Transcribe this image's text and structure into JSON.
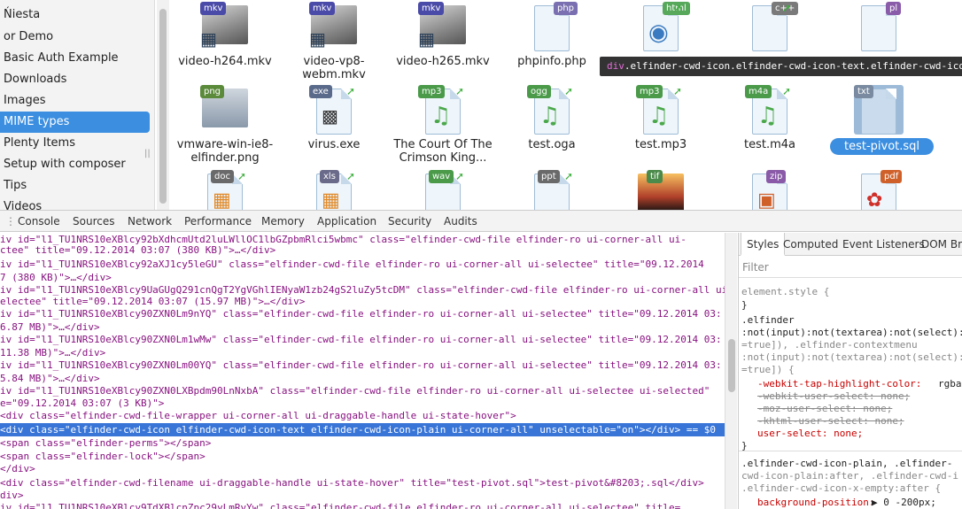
{
  "sidebar": {
    "items": [
      "Ńiesta",
      "or Demo",
      "Basic Auth Example",
      "Downloads",
      "Images",
      "MIME types",
      "Plenty Items",
      "Setup with composer",
      "Tips",
      "Videos"
    ],
    "selected": "MIME types"
  },
  "files": {
    "row1": [
      {
        "name": "video-h264.mkv",
        "badge": "mkv",
        "color": "#4a4aa8"
      },
      {
        "name": "video-vp8-webm.mkv",
        "badge": "mkv",
        "color": "#4a4aa8"
      },
      {
        "name": "video-h265.mkv",
        "badge": "mkv",
        "color": "#4a4aa8"
      },
      {
        "name": "phpinfo.php",
        "badge": "php",
        "color": "#7a6fb0"
      },
      {
        "name": "",
        "badge": "html",
        "color": "#57a85a"
      },
      {
        "name": "",
        "badge": "c++",
        "color": "#7a7a7a"
      },
      {
        "name": "",
        "badge": "pl",
        "color": "#8a5ba8"
      }
    ],
    "row2": [
      {
        "name": "vmware-win-ie8-elfinder.png",
        "badge": "png",
        "color": "#5a8a3a"
      },
      {
        "name": "virus.exe",
        "badge": "exe",
        "color": "#5a6a8a"
      },
      {
        "name": "The Court Of The Crimson King...",
        "badge": "mp3",
        "color": "#4a9a4a"
      },
      {
        "name": "test.oga",
        "badge": "ogg",
        "color": "#4a9a4a"
      },
      {
        "name": "test.mp3",
        "badge": "mp3",
        "color": "#4a9a4a"
      },
      {
        "name": "test.m4a",
        "badge": "m4a",
        "color": "#4a9a4a"
      },
      {
        "name": "test-pivot.sql",
        "badge": "txt",
        "color": "#7a8aa0"
      }
    ],
    "row3": [
      {
        "badge": "doc",
        "color": "#6a6a6a"
      },
      {
        "badge": "xls",
        "color": "#6a6a8a"
      },
      {
        "badge": "wav",
        "color": "#4a9a4a"
      },
      {
        "badge": "ppt",
        "color": "#6a6a6a"
      },
      {
        "badge": "tif",
        "color": "#4a8a4a"
      },
      {
        "badge": "zip",
        "color": "#8a5aa8"
      },
      {
        "badge": "pdf",
        "color": "#d0602a"
      }
    ]
  },
  "tooltip": {
    "tag": "div",
    "classes": ".elfinder-cwd-icon.elfinder-cwd-icon-text.elfinder-cwd-icon-plai"
  },
  "devtools": {
    "tabs": [
      "Console",
      "Sources",
      "Network",
      "Performance",
      "Memory",
      "Application",
      "Security",
      "Audits"
    ],
    "styles_tabs": [
      "Styles",
      "Computed",
      "Event Listeners",
      "DOM Bre"
    ],
    "filter_placeholder": "Filter",
    "element_lines": [
      "iv id=\"l1_TU1NRS10eXBlcy92bXdhcmUtd2luLWllOC1lbGZpbmRlci5wbmc\" class=\"elfinder-cwd-file elfinder-ro ui-corner-all ui-",
      "ctee\" title=\"09.12.2014 03:07 (380 KB)\">…</div>",
      "iv id=\"l1_TU1NRS10eXBlcy92aXJ1cy5leGU\" class=\"elfinder-cwd-file elfinder-ro ui-corner-all ui-selectee\" title=\"09.12.2014",
      "7 (380 KB)\">…</div>",
      "iv id=\"l1_TU1NRS10eXBlcy9UaGUgQ291cnQgT2YgVGhlIENyaW1zb24gS2luZy5tcDM\" class=\"elfinder-cwd-file elfinder-ro ui-corner-all ui-",
      "electee\" title=\"09.12.2014 03:07 (15.97 MB)\">…</div>",
      "iv id=\"l1_TU1NRS10eXBlcy90ZXN0Lm9nYQ\" class=\"elfinder-cwd-file elfinder-ro ui-corner-all ui-selectee\" title=\"09.12.2014 03:",
      "6.87 MB)\">…</div>",
      "iv id=\"l1_TU1NRS10eXBlcy90ZXN0Lm1wMw\" class=\"elfinder-cwd-file elfinder-ro ui-corner-all ui-selectee\" title=\"09.12.2014 03:",
      "11.38 MB)\">…</div>",
      "iv id=\"l1_TU1NRS10eXBlcy90ZXN0Lm00YQ\" class=\"elfinder-cwd-file elfinder-ro ui-corner-all ui-selectee\" title=\"09.12.2014 03:",
      "5.84 MB)\">…</div>",
      "iv id=\"l1_TU1NRS10eXBlcy90ZXN0LXBpdm90LnNxbA\" class=\"elfinder-cwd-file elfinder-ro ui-corner-all ui-selectee ui-selected\"",
      "e=\"09.12.2014 03:07 (3 KB)\">",
      "<div class=\"elfinder-cwd-file-wrapper ui-corner-all ui-draggable-handle ui-state-hover\">",
      "  <div class=\"elfinder-cwd-icon elfinder-cwd-icon-text elfinder-cwd-icon-plain ui-corner-all\" unselectable=\"on\"></div> == $0",
      "  <span class=\"elfinder-perms\"></span>",
      "  <span class=\"elfinder-lock\"></span>",
      "</div>",
      "<div class=\"elfinder-cwd-filename ui-draggable-handle ui-state-hover\" title=\"test-pivot.sql\">test-pivot&#8203;.sql</div>",
      "div>",
      "iv id=\"l1_TU1NRS10eXBlcy9TdXBlcnZpc29yLmRvYw\" class=\"elfinder-cwd-file elfinder-ro ui-corner-all ui-selectee\" title="
    ],
    "styles_lines": [
      "element.style {",
      "}",
      ".elfinder",
      ":not(input):not(textarea):not(select):",
      "=true]), .elfinder-contextmenu",
      ":not(input):not(textarea):not(select):",
      "=true]) {",
      "-webkit-tap-highlight-color:",
      "rgba",
      "-webkit-user-select: none;",
      "-moz-user-select: none;",
      "-khtml-user-select: none;",
      "user-select: none;",
      "}",
      ".elfinder-cwd-icon-plain, .elfinder-",
      "cwd-icon-plain:after, .elfinder-cwd-i",
      ".elfinder-cwd-icon-x-empty:after {",
      "background-position:",
      "▶ 0 -200px;"
    ]
  }
}
